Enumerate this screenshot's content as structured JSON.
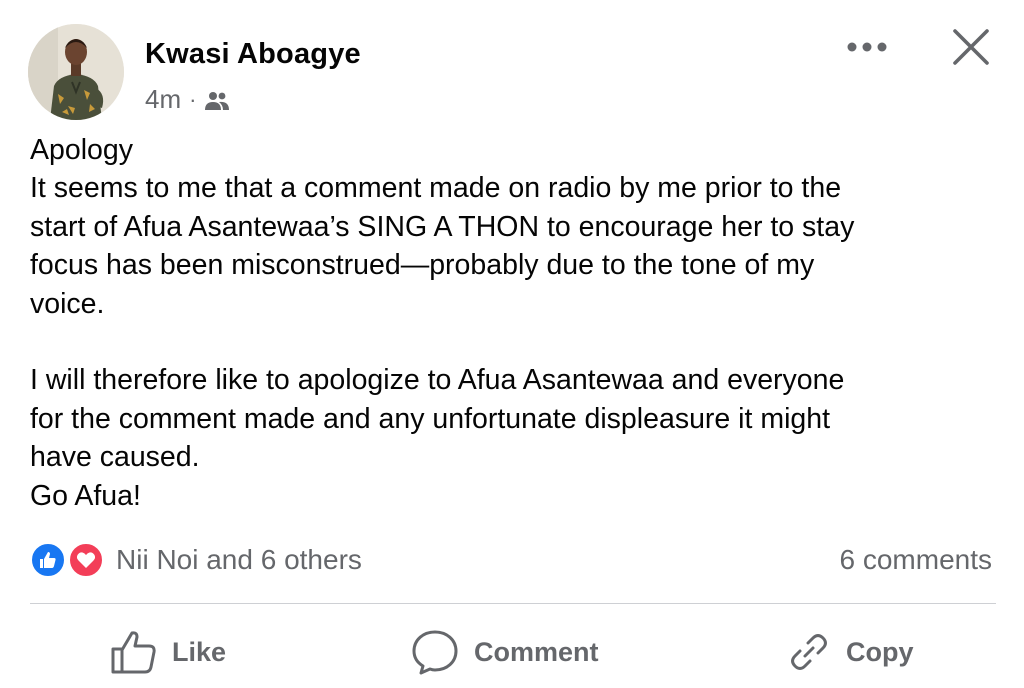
{
  "post": {
    "author": {
      "name": "Kwasi Aboagye"
    },
    "meta": {
      "time": "4m",
      "separator": "·",
      "audience_icon": "friends-icon"
    },
    "header_actions": {
      "more_icon": "more-options-icon",
      "close_icon": "close-icon"
    },
    "text_lines": [
      "Apology",
      "It seems to me that a comment made on radio by me prior to the",
      "start of Afua Asantewaa’s SING A THON to encourage her to stay",
      "focus has been misconstrued—probably due to the tone of my",
      "voice.",
      "",
      "I will therefore like to apologize to Afua Asantewaa and everyone",
      "for the comment made and any unfortunate displeasure it might",
      "have caused.",
      "Go Afua!"
    ],
    "reactions": {
      "types": [
        "like",
        "love"
      ],
      "summary": "Nii Noi and 6 others"
    },
    "comments_count": "6 comments",
    "actions": {
      "like": "Like",
      "comment": "Comment",
      "copy": "Copy"
    },
    "colors": {
      "like_blue": "#1877f2",
      "love_red": "#f33e58",
      "secondary_text": "#65676b",
      "primary_text": "#050505"
    }
  }
}
